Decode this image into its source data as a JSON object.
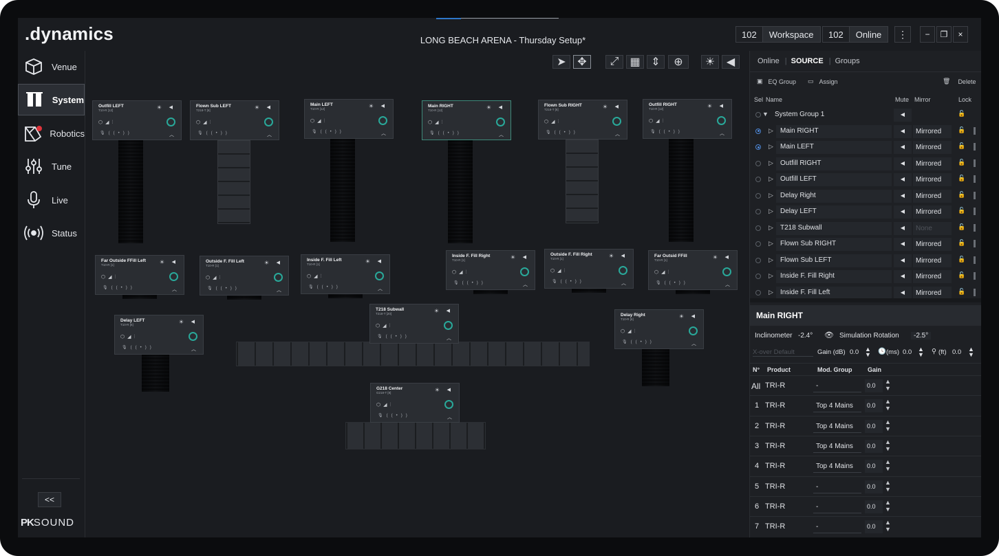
{
  "app": {
    "logo": ".dynamics",
    "title": "LONG BEACH ARENA - Thursday Setup*",
    "workspace": {
      "num": "102",
      "label": "Workspace"
    },
    "online": {
      "num": "102",
      "label": "Online"
    },
    "menu_icon": "vertical-dots-icon",
    "window": {
      "minimize": "−",
      "restore": "❐",
      "close": "×"
    }
  },
  "sidebar": {
    "items": [
      {
        "label": "Venue",
        "icon": "cube-icon"
      },
      {
        "label": "System",
        "icon": "system-icon"
      },
      {
        "label": "Robotics",
        "icon": "robotics-icon"
      },
      {
        "label": "Tune",
        "icon": "sliders-icon"
      },
      {
        "label": "Live",
        "icon": "microphone-icon"
      },
      {
        "label": "Status",
        "icon": "broadcast-icon"
      }
    ],
    "active": "System",
    "collapse": "<<",
    "brand_pk": "PK",
    "brand_sound": "SOUND"
  },
  "toolbar": {
    "icons": [
      "pointer-icon",
      "move-icon",
      "fit-icon",
      "grid-icon",
      "align-icon",
      "zoom-icon",
      "brightness-icon",
      "speaker-icon"
    ]
  },
  "cards": [
    {
      "name": "Outfill LEFT",
      "sub": "T10-R [12]"
    },
    {
      "name": "Flown Sub LEFT",
      "sub": "T218-T [6]"
    },
    {
      "name": "Main LEFT",
      "sub": "T10-R [12]"
    },
    {
      "name": "Main RIGHT",
      "sub": "T10-R [12]"
    },
    {
      "name": "Flown Sub RIGHT",
      "sub": "T218-T [6]"
    },
    {
      "name": "Outfill RIGHT",
      "sub": "T10-R [12]"
    },
    {
      "name": "Far Outside FFill Left",
      "sub": "T10-R [1]"
    },
    {
      "name": "Outside F. Fill Left",
      "sub": "T10-R [1]"
    },
    {
      "name": "Inside F. Fill Left",
      "sub": "T10-R [1]"
    },
    {
      "name": "Inside F. Fill Right",
      "sub": "T10-R [1]"
    },
    {
      "name": "Outside F. Fill Right",
      "sub": "T10-R [1]"
    },
    {
      "name": "Far Outsid FFill",
      "sub": "T10-R [1]"
    },
    {
      "name": "Delay LEFT",
      "sub": "T10-R [6]"
    },
    {
      "name": "T218 Subwall",
      "sub": "T218-T [20]"
    },
    {
      "name": "Delay Right",
      "sub": "T10-R [6]"
    },
    {
      "name": "G218 Center",
      "sub": "G218-T [8]"
    }
  ],
  "panel": {
    "tabs": [
      "Online",
      "SOURCE",
      "Groups"
    ],
    "active_tab": "SOURCE",
    "eq_group": "EQ Group",
    "assign": "Assign",
    "delete": "Delete",
    "headers": {
      "sel": "Sel",
      "name": "Name",
      "mute": "Mute",
      "mirror": "Mirror",
      "lock": "Lock"
    },
    "sources": [
      {
        "name": "System Group 1",
        "group": true,
        "selected": false,
        "mirror": ""
      },
      {
        "name": "Main RIGHT",
        "selected": true,
        "mirror": "Mirrored"
      },
      {
        "name": "Main LEFT",
        "selected": true,
        "mirror": "Mirrored"
      },
      {
        "name": "Outfill RIGHT",
        "selected": false,
        "mirror": "Mirrored"
      },
      {
        "name": "Outfill LEFT",
        "selected": false,
        "mirror": "Mirrored"
      },
      {
        "name": "Delay Right",
        "selected": false,
        "mirror": "Mirrored"
      },
      {
        "name": "Delay LEFT",
        "selected": false,
        "mirror": "Mirrored"
      },
      {
        "name": "T218 Subwall",
        "selected": false,
        "mirror": "None"
      },
      {
        "name": "Flown Sub RIGHT",
        "selected": false,
        "mirror": "Mirrored"
      },
      {
        "name": "Flown Sub LEFT",
        "selected": false,
        "mirror": "Mirrored"
      },
      {
        "name": "Inside F. Fill Right",
        "selected": false,
        "mirror": "Mirrored"
      },
      {
        "name": "Inside F. Fill Left",
        "selected": false,
        "mirror": "Mirrored"
      }
    ],
    "detail": {
      "title": "Main RIGHT",
      "inclinometer_label": "Inclinometer",
      "inclinometer_value": "-2.4°",
      "sim_rotation_label": "Simulation Rotation",
      "sim_rotation_value": "-2.5°",
      "xover_placeholder": "X-over Default",
      "gain_label": "Gain (dB)",
      "gain_value": "0.0",
      "delay_label": "(ms)",
      "delay_value": "0.0",
      "dist_label": "(ft)",
      "dist_value": "0.0",
      "headers": {
        "n": "N°",
        "product": "Product",
        "mod": "Mod. Group",
        "gain": "Gain"
      },
      "rows": [
        {
          "n": "All",
          "product": "TRI-R",
          "mod": "-",
          "gain": "0.0"
        },
        {
          "n": "1",
          "product": "TRI-R",
          "mod": "Top 4 Mains",
          "gain": "0.0"
        },
        {
          "n": "2",
          "product": "TRI-R",
          "mod": "Top 4 Mains",
          "gain": "0.0"
        },
        {
          "n": "3",
          "product": "TRI-R",
          "mod": "Top 4 Mains",
          "gain": "0.0"
        },
        {
          "n": "4",
          "product": "TRI-R",
          "mod": "Top 4 Mains",
          "gain": "0.0"
        },
        {
          "n": "5",
          "product": "TRI-R",
          "mod": "-",
          "gain": "0.0"
        },
        {
          "n": "6",
          "product": "TRI-R",
          "mod": "-",
          "gain": "0.0"
        },
        {
          "n": "7",
          "product": "TRI-R",
          "mod": "-",
          "gain": "0.0"
        }
      ]
    }
  }
}
